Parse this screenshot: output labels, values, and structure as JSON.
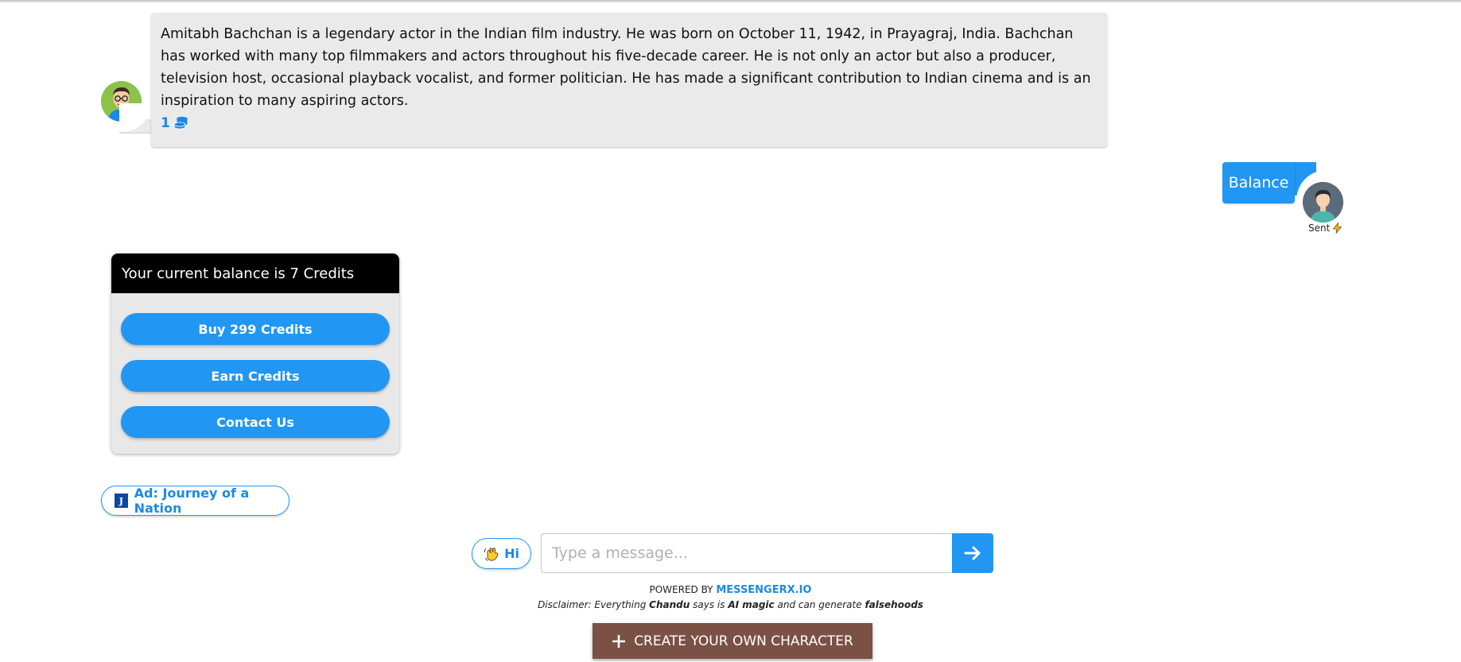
{
  "bot_message": {
    "text": "Amitabh Bachchan is a legendary actor in the Indian film industry. He was born on October 11, 1942, in Prayagraj, India. Bachchan has worked with many top filmmakers and actors throughout his five-decade career. He is not only an actor but also a producer, television host, occasional playback vocalist, and former politician. He has made a significant contribution to Indian cinema and is an inspiration to many aspiring actors.",
    "credit_cost": "1",
    "credit_icon": "coins-icon"
  },
  "user_message": {
    "text": "Balance",
    "status": "Sent",
    "status_icon": "lightning-icon"
  },
  "balance_card": {
    "header": "Your current balance is 7 Credits",
    "buttons": [
      {
        "label": "Buy 299 Credits"
      },
      {
        "label": "Earn Credits"
      },
      {
        "label": "Contact Us"
      }
    ]
  },
  "ad_chip": {
    "logo_letter": "J",
    "label": "Ad: Journey of a Nation"
  },
  "composer": {
    "quick_reply": "Hi",
    "placeholder": "Type a message...",
    "send_icon": "arrow-right-icon"
  },
  "footer": {
    "powered_prefix": "POWERED BY",
    "powered_brand": "MESSENGERX.IO",
    "disclaimer_pre": "Disclaimer: Everything",
    "disclaimer_name": "Chandu",
    "disclaimer_mid": "says is",
    "disclaimer_magic": "AI magic",
    "disclaimer_post": "and can generate",
    "disclaimer_end": "falsehoods",
    "create_button": "CREATE YOUR OWN CHARACTER"
  },
  "colors": {
    "accent": "#2196f3",
    "bot_bubble": "#eaeaea",
    "card_header": "#000000",
    "create_button": "#7b5145"
  }
}
